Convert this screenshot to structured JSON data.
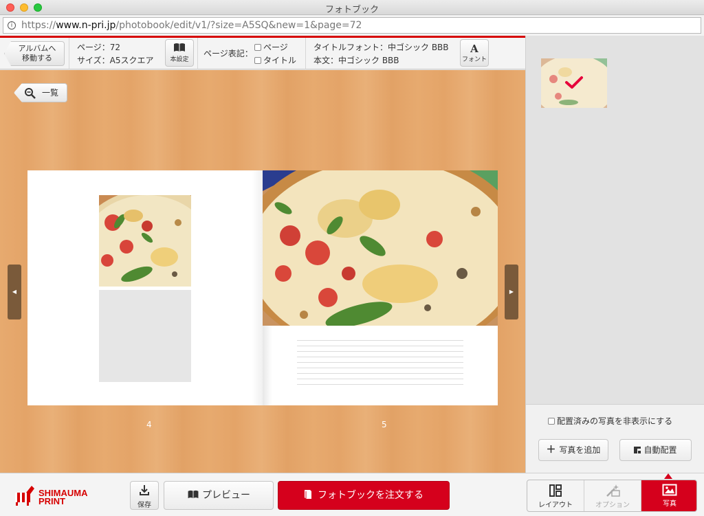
{
  "window": {
    "title": "フォトブック",
    "url_prefix": "https://",
    "url_host": "www.n-pri.jp",
    "url_path": "/photobook/edit/v1/?size=A5SQ&new=1&page=72"
  },
  "toolbar": {
    "back_line1": "アルバムへ",
    "back_line2": "移動する",
    "page_info": "ページ：72",
    "size_info": "サイズ：A5スクエア",
    "book_settings_label": "本設定",
    "page_display_label": "ページ表記：",
    "page_checkbox_label": "ページ",
    "title_checkbox_label": "タイトル",
    "title_font_info": "タイトルフォント：中ゴシック BBB",
    "body_font_info": "本文：中ゴシック BBB",
    "font_glyph": "A",
    "font_label": "フォント"
  },
  "canvas": {
    "overview_label": "一覧",
    "left_page_number": "4",
    "right_page_number": "5"
  },
  "right_panel": {
    "hide_placed_label": "配置済みの写真を非表示にする",
    "add_photo_label": "写真を追加",
    "auto_place_label": "自動配置"
  },
  "bottom": {
    "brand_line1": "SHIMAUMA",
    "brand_line2": "PRINT",
    "save_label": "保存",
    "preview_label": "プレビュー",
    "order_label": "フォトブックを注文する",
    "tabs": [
      {
        "label": "レイアウト",
        "state": "normal"
      },
      {
        "label": "オプション",
        "state": "disabled"
      },
      {
        "label": "写真",
        "state": "active"
      }
    ]
  },
  "colors": {
    "accent": "#d5001c",
    "wood": "#e7aa6f"
  },
  "icons": {
    "overview": "magnifier-icon",
    "book": "open-book-icon",
    "save": "download-icon",
    "placed": "checkmark-icon"
  }
}
